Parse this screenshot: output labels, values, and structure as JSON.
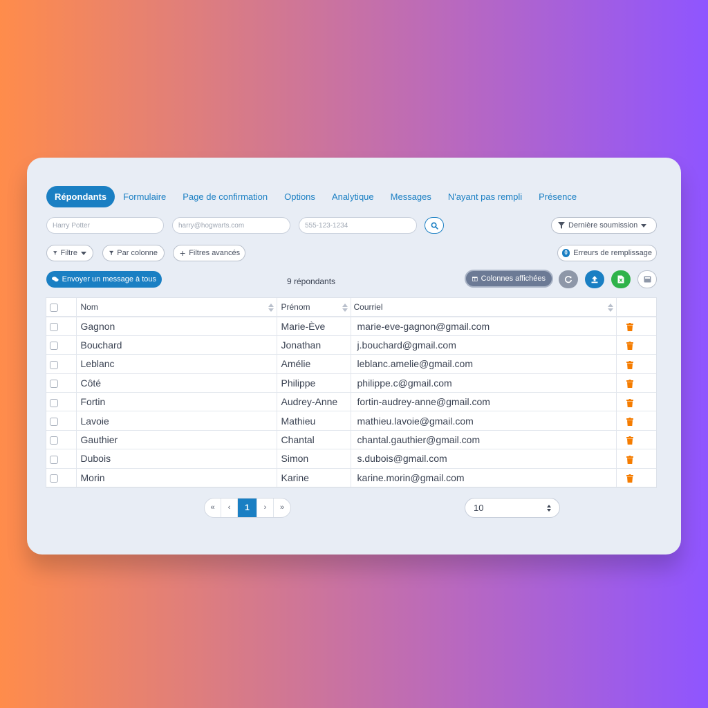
{
  "tabs": [
    {
      "label": "Répondants",
      "active": true
    },
    {
      "label": "Formulaire"
    },
    {
      "label": "Page de confirmation"
    },
    {
      "label": "Options"
    },
    {
      "label": "Analytique"
    },
    {
      "label": "Messages"
    },
    {
      "label": "N'ayant pas rempli"
    },
    {
      "label": "Présence"
    }
  ],
  "search": {
    "name_placeholder": "Harry Potter",
    "email_placeholder": "harry@hogwarts.com",
    "phone_placeholder": "555-123-1234"
  },
  "sort_dropdown": {
    "label": "Dernière soumission"
  },
  "filters": {
    "filter_label": "Filtre",
    "by_column_label": "Par colonne",
    "advanced_label": "Filtres avancés"
  },
  "errors": {
    "count": "0",
    "label": "Erreurs de remplissage"
  },
  "actions": {
    "message_all_label": "Envoyer un message à tous",
    "columns_label": "Colonnes affichées"
  },
  "respondent_count": "9 répondants",
  "table": {
    "headers": {
      "name": "Nom",
      "first_name": "Prénom",
      "email": "Courriel"
    },
    "rows": [
      {
        "name": "Gagnon",
        "first_name": "Marie-Ève",
        "email": "marie-eve-gagnon@gmail.com"
      },
      {
        "name": "Bouchard",
        "first_name": "Jonathan",
        "email": "j.bouchard@gmail.com"
      },
      {
        "name": "Leblanc",
        "first_name": "Amélie",
        "email": "leblanc.amelie@gmail.com"
      },
      {
        "name": "Côté",
        "first_name": "Philippe",
        "email": "philippe.c@gmail.com"
      },
      {
        "name": "Fortin",
        "first_name": "Audrey-Anne",
        "email": "fortin-audrey-anne@gmail.com"
      },
      {
        "name": "Lavoie",
        "first_name": "Mathieu",
        "email": "mathieu.lavoie@gmail.com"
      },
      {
        "name": "Gauthier",
        "first_name": "Chantal",
        "email": "chantal.gauthier@gmail.com"
      },
      {
        "name": "Dubois",
        "first_name": "Simon",
        "email": "s.dubois@gmail.com"
      },
      {
        "name": "Morin",
        "first_name": "Karine",
        "email": "karine.morin@gmail.com"
      }
    ]
  },
  "pagination": {
    "first": "«",
    "prev": "‹",
    "current": "1",
    "next": "›",
    "last": "»"
  },
  "page_size": "10",
  "colors": {
    "primary": "#1a7fc3",
    "trash": "#f57c00",
    "excel_green": "#2fb34a",
    "gray_button": "#8e97a8"
  }
}
